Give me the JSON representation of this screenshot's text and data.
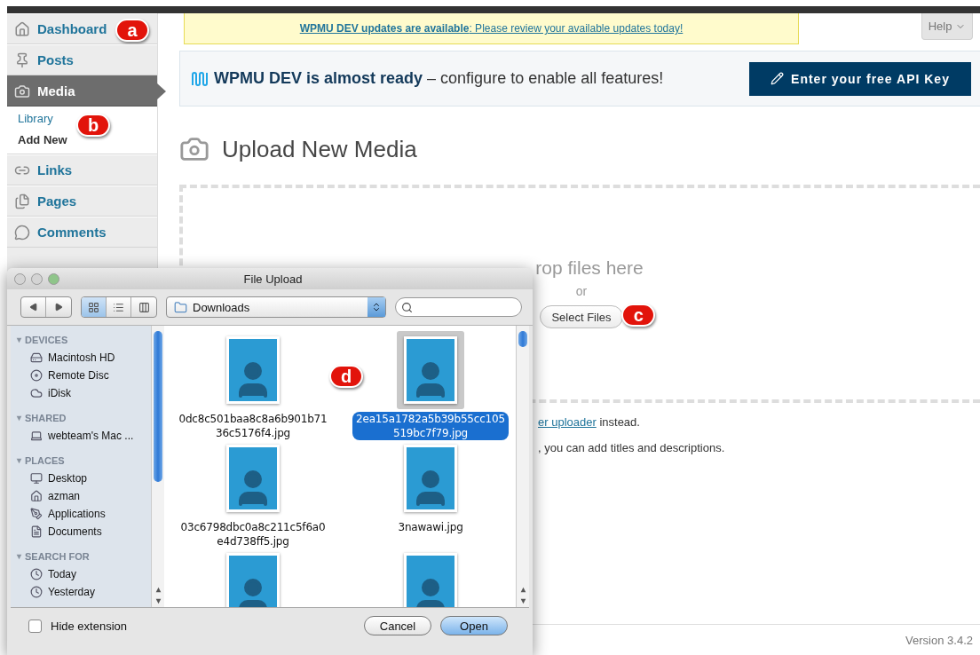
{
  "sidebar": {
    "items": [
      {
        "label": "Dashboard",
        "kind": "dashboard",
        "selected": false,
        "badge": "a"
      },
      {
        "label": "Posts",
        "kind": "posts",
        "selected": false
      },
      {
        "label": "Media",
        "kind": "media",
        "selected": true,
        "children": [
          {
            "label": "Library",
            "selected": false
          },
          {
            "label": "Add New",
            "selected": true
          }
        ],
        "badge": "b"
      },
      {
        "label": "Links",
        "kind": "links",
        "selected": false
      },
      {
        "label": "Pages",
        "kind": "pages",
        "selected": false
      },
      {
        "label": "Comments",
        "kind": "comments",
        "selected": false
      }
    ]
  },
  "notice": {
    "text": "**WPMU DEV updates are available**: Please review your available updates today!"
  },
  "help_tab": {
    "label": "Help"
  },
  "banner": {
    "text": "**WPMU DEV is almost ready** – configure to enable all features!",
    "button": "Enter your free API Key"
  },
  "page_title": "Upload New Media",
  "drop_zone": {
    "heading": "rop files here",
    "or": "or",
    "button": "Select Files",
    "badge": "c"
  },
  "notes": [
    {
      "link": "er uploader",
      "text": "instead."
    },
    {
      "text": ", you can add titles and descriptions."
    }
  ],
  "footer": {
    "version": "Version 3.4.2"
  },
  "dialog": {
    "title": "File Upload",
    "view_modes": [
      {
        "kind": "icons",
        "selected": true
      },
      {
        "kind": "list",
        "selected": false
      },
      {
        "kind": "columns",
        "selected": false
      }
    ],
    "location": "Downloads",
    "sections": [
      {
        "label": "DEVICES",
        "items": [
          {
            "label": "Macintosh HD",
            "kind": "disk"
          },
          {
            "label": "Remote Disc",
            "kind": "disc"
          },
          {
            "label": "iDisk",
            "kind": "idisk"
          }
        ]
      },
      {
        "label": "SHARED",
        "items": [
          {
            "label": "webteam's Mac ...",
            "kind": "computer"
          }
        ]
      },
      {
        "label": "PLACES",
        "items": [
          {
            "label": "Desktop",
            "kind": "desktop"
          },
          {
            "label": "azman",
            "kind": "home"
          },
          {
            "label": "Applications",
            "kind": "apps"
          },
          {
            "label": "Documents",
            "kind": "documents"
          }
        ]
      },
      {
        "label": "SEARCH FOR",
        "items": [
          {
            "label": "Today",
            "kind": "clock"
          },
          {
            "label": "Yesterday",
            "kind": "clock"
          }
        ]
      }
    ],
    "files": [
      {
        "name": "0dc8c501baa8c8a6b901b7136c5176f4.jpg",
        "selected": false
      },
      {
        "name": "2ea15a1782a5b39b55cc105519bc7f79.jpg",
        "selected": true,
        "badge": "d"
      },
      {
        "name": "03c6798dbc0a8c211c5f6a0e4d738ff5.jpg",
        "selected": false
      },
      {
        "name": "3nawawi.jpg",
        "selected": false
      },
      {
        "selected": false
      },
      {
        "selected": false
      }
    ],
    "hide_extension": {
      "label": "Hide extension",
      "checked": false
    },
    "buttons": [
      {
        "label": "Cancel",
        "default": false
      },
      {
        "label": "Open",
        "default": true
      }
    ]
  }
}
